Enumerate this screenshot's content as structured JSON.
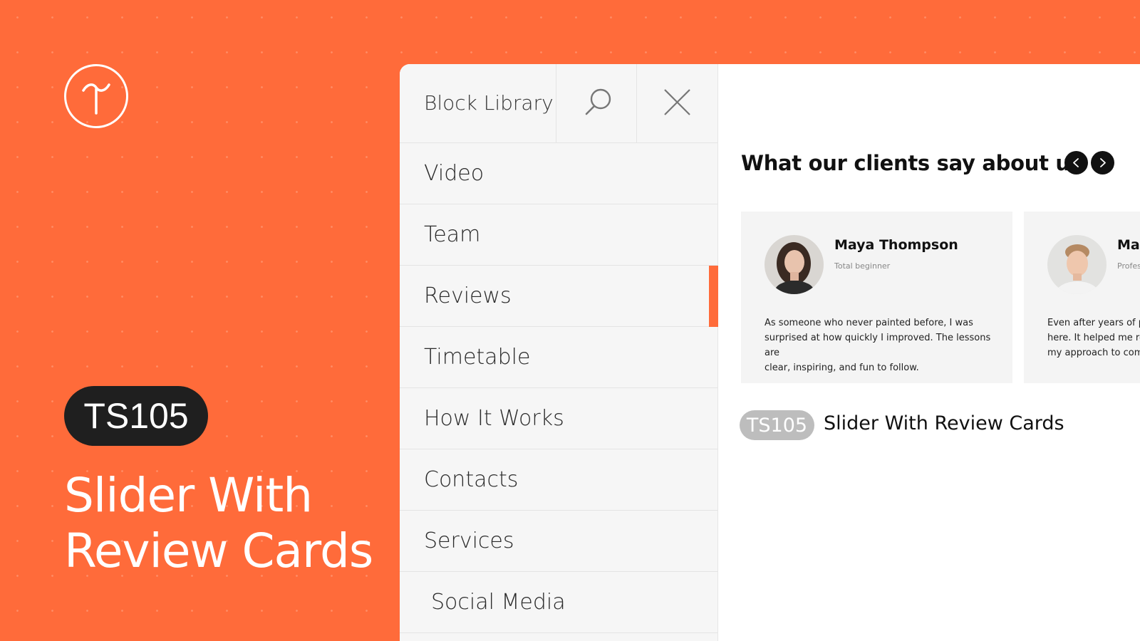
{
  "brand": {
    "logo_icon": "tilda-logo-icon",
    "code": "TS105",
    "title_line1": "Slider With",
    "title_line2": "Review Cards",
    "background_color": "#ff6b3a"
  },
  "sidebar": {
    "title": "Block Library",
    "search_icon": "search-icon",
    "close_icon": "close-icon",
    "items": [
      {
        "label": "Video",
        "active": false
      },
      {
        "label": "Team",
        "active": false
      },
      {
        "label": "Reviews",
        "active": true
      },
      {
        "label": "Timetable",
        "active": false
      },
      {
        "label": "How It Works",
        "active": false
      },
      {
        "label": "Contacts",
        "active": false
      },
      {
        "label": "Services",
        "active": false
      },
      {
        "label": "Social Media",
        "active": false
      }
    ],
    "accent_color": "#ff6b3a"
  },
  "preview": {
    "heading": "What our clients say about us",
    "prev_icon": "chevron-left-icon",
    "next_icon": "chevron-right-icon",
    "cards": [
      {
        "name": "Maya Thompson",
        "role": "Total beginner",
        "text": "As someone who never painted before, I was\nsurprised at how quickly I improved. The lessons are\nclear, inspiring, and fun to follow."
      },
      {
        "name": "Mat",
        "role": "Profess",
        "text": "Even after years of pa\nhere. It helped me refi\nmy approach to comp"
      }
    ],
    "badge": "TS105",
    "caption": "Slider With Review Cards"
  }
}
